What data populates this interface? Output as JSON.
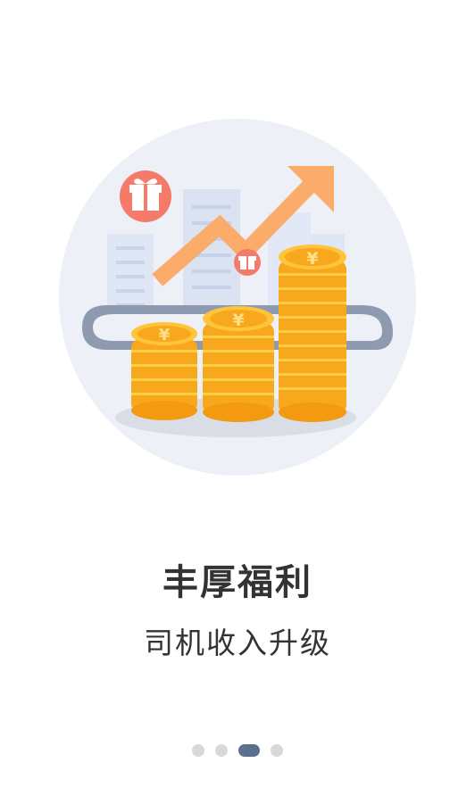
{
  "onboarding": {
    "title": "丰厚福利",
    "subtitle": "司机收入升级",
    "page_indicator": {
      "total": 4,
      "active_index": 2
    }
  },
  "illustration": {
    "subject": "coin-stacks-growth",
    "currency_symbol": "¥",
    "colors": {
      "circle_bg": "#eef0f7",
      "coin": "#f8a81c",
      "coin_light": "#ffd04a",
      "arrow": "#fbab6a",
      "gift": "#f47a6a",
      "buildings": "#dde4f2",
      "track": "#8e9aaf"
    }
  }
}
